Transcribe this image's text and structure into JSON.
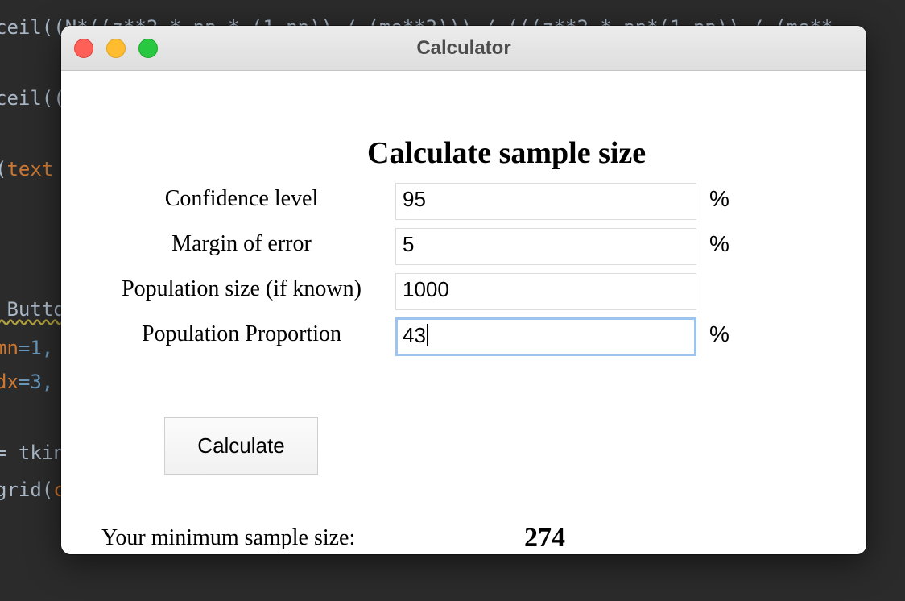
{
  "editor": {
    "lines": [
      {
        "a": "ceil((N*((z**2 * pp * (1-pp)) / (me**2))) / (((z**2 * pp*(1-pp)) / (me**",
        "b": "",
        "c": ""
      },
      {
        "a": "ceil((",
        "b": "",
        "c": ""
      },
      {
        "a": "(",
        "b": "text",
        "c": ""
      },
      {
        "a": " Butto",
        "b": "",
        "c": ""
      },
      {
        "a": "mn",
        "b": "=1,",
        "c": ""
      },
      {
        "a": "dx",
        "b": "=3,",
        "c": ""
      },
      {
        "a": "= tkin",
        "b": "",
        "c": ""
      },
      {
        "a": "grid(",
        "b": "c",
        "c": ""
      }
    ]
  },
  "window": {
    "title": "Calculator"
  },
  "form": {
    "heading": "Calculate sample size",
    "fields": [
      {
        "label": "Confidence level",
        "value": "95",
        "unit": "%"
      },
      {
        "label": "Margin of error",
        "value": "5",
        "unit": "%"
      },
      {
        "label": "Population size (if known)",
        "value": "1000",
        "unit": ""
      },
      {
        "label": "Population Proportion",
        "value": "43",
        "unit": "%"
      }
    ],
    "calculate_label": "Calculate"
  },
  "result": {
    "label": "Your minimum sample size:",
    "value": "274"
  },
  "colors": {
    "focus_ring": "#9cc4ef",
    "close": "#fe5f57",
    "minimize": "#febc2e",
    "maximize": "#28c840"
  }
}
